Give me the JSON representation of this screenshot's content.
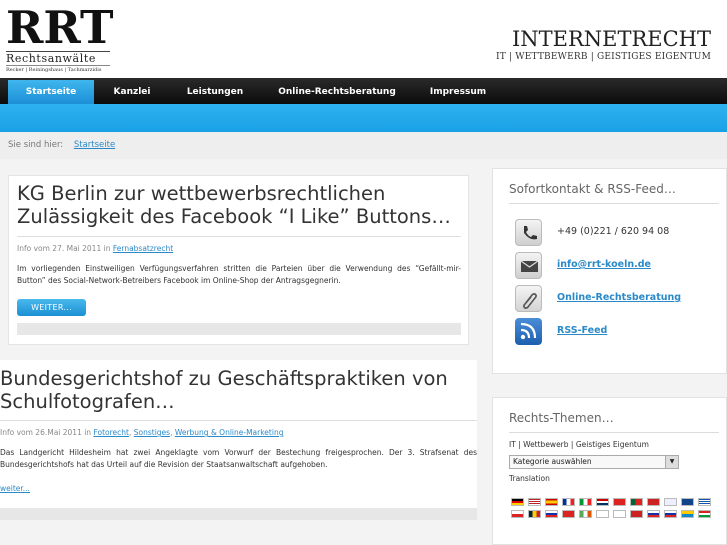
{
  "logo": {
    "big": "RRT",
    "sub": "Rechtsanwälte",
    "names": "Recker | Reiningshaus | Tachmarzidis"
  },
  "brand": {
    "title": "INTERNETRECHT",
    "subtitle": "IT | WETTBEWERB | GEISTIGES EIGENTUM"
  },
  "nav": {
    "items": [
      {
        "label": "Startseite",
        "active": true
      },
      {
        "label": "Kanzlei"
      },
      {
        "label": "Leistungen"
      },
      {
        "label": "Online-Rechtsberatung"
      },
      {
        "label": "Impressum"
      }
    ]
  },
  "breadcrumb": {
    "prefix": "Sie sind hier:",
    "current": "Startseite"
  },
  "posts": [
    {
      "title": "KG Berlin zur wettbewerbsrechtlichen Zulässigkeit des Facebook “I Like” Buttons…",
      "meta_prefix": "Info vom 27. Mai 2011 in ",
      "categories": [
        "Fernabsatzrecht"
      ],
      "excerpt": "Im vorliegenden Einstweiligen Verfügungsverfahren stritten die Parteien über die Verwendung des “Gefällt-mir-Button” des Social-Network-Betreibers Facebook im Online-Shop der Antragsgegnerin.",
      "more_label": "WEITER..."
    },
    {
      "title": "Bundesgerichtshof zu Geschäftspraktiken von Schulfotografen…",
      "meta_prefix": "Info vom 26.Mai 2011 in ",
      "categories": [
        "Fotorecht",
        "Sonstiges",
        "Werbung & Online-Marketing"
      ],
      "excerpt": "Das Landgericht Hildesheim hat zwei Angeklagte vom Vorwurf der Bestechung freigesprochen. Der 3. Strafsenat des Bundesgerichtshofs hat das Urteil auf die Revision der Staatsanwaltschaft aufgehoben.",
      "more_label": "weiter..."
    }
  ],
  "sidebar": {
    "contact": {
      "title": "Sofortkontakt & RSS-Feed…",
      "phone": "+49 (0)221 / 620 94 08",
      "email": "info@rrt-koeln.de",
      "online": "Online-Rechtsberatung",
      "rss": "RSS-Feed"
    },
    "themes": {
      "title": "Rechts-Themen…",
      "subtitle": "IT | Wettbewerb | Geistiges Eigentum",
      "select_value": "Kategorie auswählen",
      "translation_label": "Translation"
    }
  },
  "colors": {
    "accent": "#1aa0e6",
    "nav_bg": "#111111",
    "link": "#2a8ac8"
  }
}
